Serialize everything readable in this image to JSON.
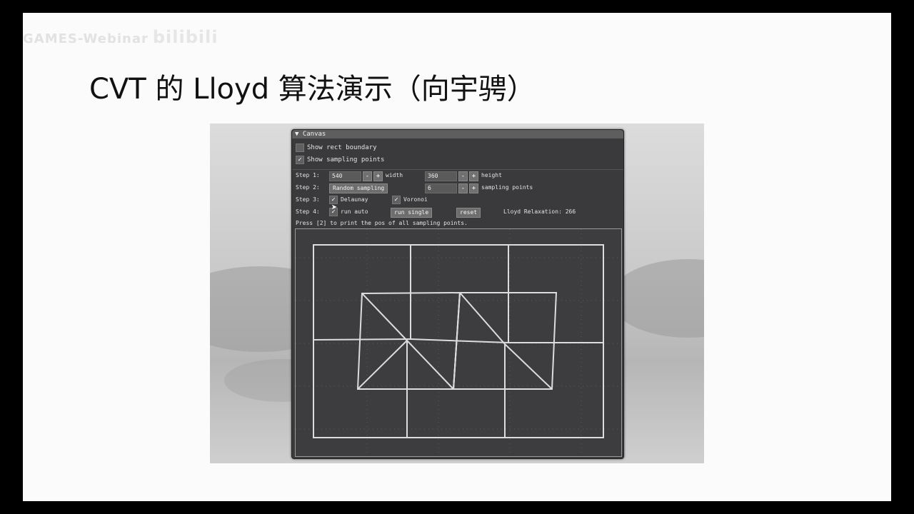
{
  "watermark": {
    "text": "GAMES-Webinar",
    "logo": "bilibili"
  },
  "slide": {
    "title": "CVT 的 Lloyd 算法演示（向宇骋）"
  },
  "window": {
    "title": "Canvas",
    "show_rect_boundary": {
      "label": "Show rect boundary",
      "checked": false
    },
    "show_sampling_points": {
      "label": "Show sampling points",
      "checked": true
    },
    "step1": {
      "label": "Step 1:",
      "width_value": "540",
      "width_label": "width",
      "height_value": "360",
      "height_label": "height"
    },
    "step2": {
      "label": "Step 2:",
      "button": "Random sampling",
      "count_value": "6",
      "count_label": "sampling points"
    },
    "step3": {
      "label": "Step 3:",
      "delaunay": {
        "label": "Delaunay",
        "checked": true
      },
      "voronoi": {
        "label": "Voronoi",
        "checked": true
      }
    },
    "step4": {
      "label": "Step 4:",
      "run_auto": {
        "label": "run auto",
        "checked": true
      },
      "run_single": "run single",
      "reset": "reset",
      "relaxation_label": "Lloyd Relaxation: 266"
    },
    "hint": "Press [2] to print the pos of all sampling points.",
    "minus": "-",
    "plus": "+"
  },
  "colors": {
    "panel": "#3a3a3c",
    "canvas": "#3d3d40",
    "lines": "#d9d9d9"
  }
}
